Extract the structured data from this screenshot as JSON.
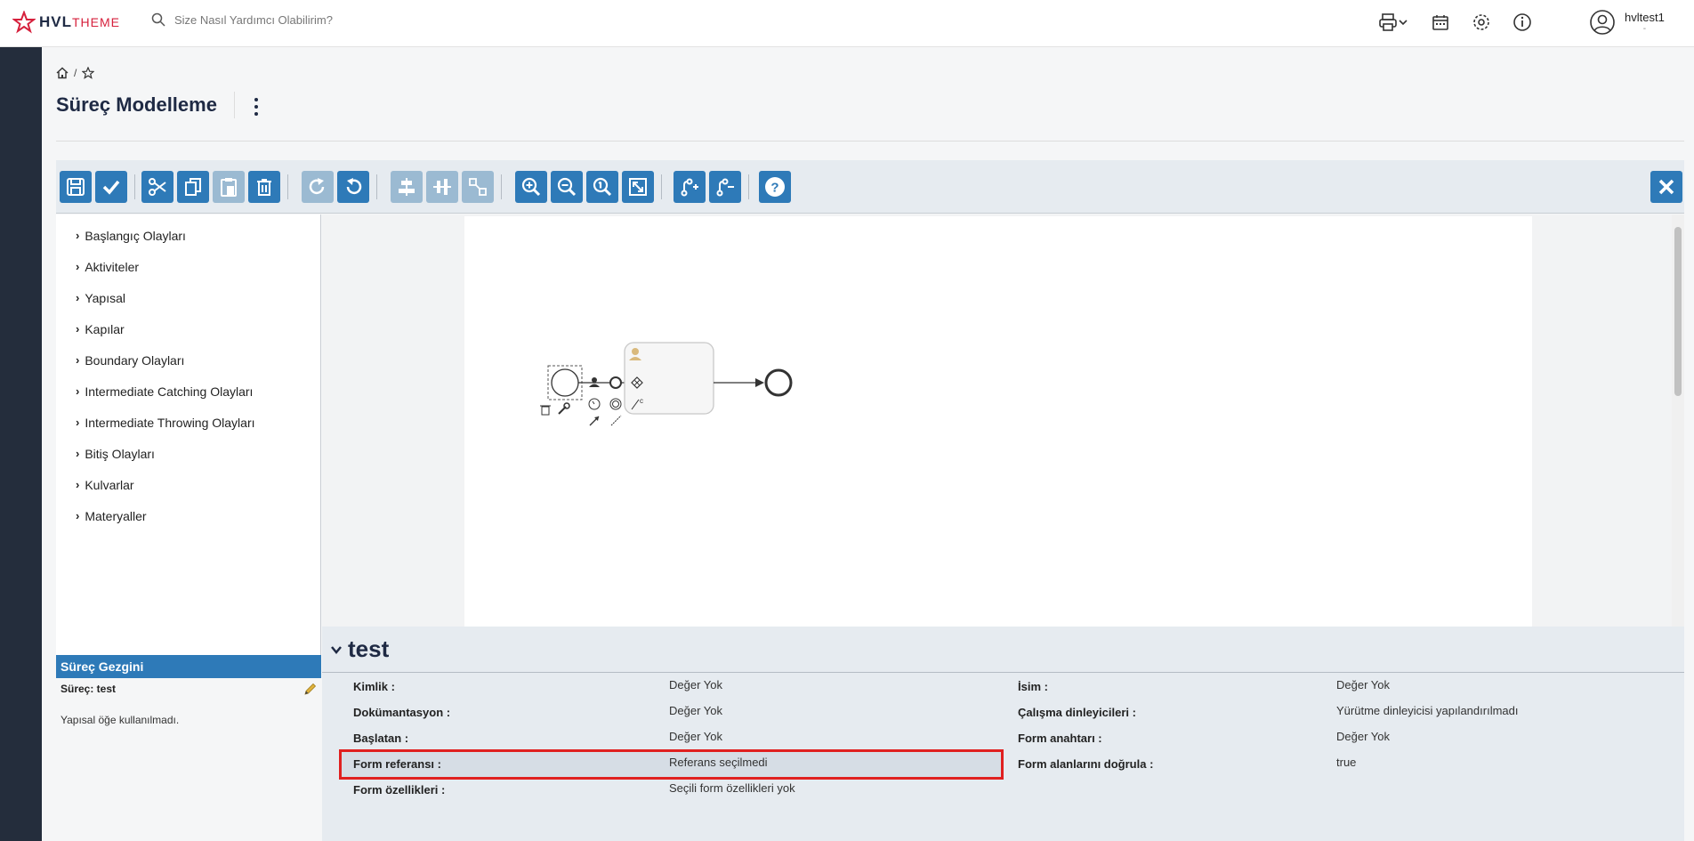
{
  "header": {
    "logo_main": "HVL",
    "logo_sub": "THEME",
    "search_placeholder": "Size Nasıl Yardımcı Olabilirim?",
    "user_name": "hvltest1",
    "user_sub": "-",
    "icons": [
      "print-icon",
      "chevron-down-icon",
      "calendar-icon",
      "gear-icon",
      "info-icon",
      "user-icon"
    ]
  },
  "breadcrumb": {
    "separator": "/"
  },
  "page": {
    "title": "Süreç Modelleme"
  },
  "toolbar": {
    "buttons": [
      "save-icon",
      "check-icon",
      "cut-icon",
      "copy-icon",
      "paste-icon",
      "delete-icon",
      "redo-icon",
      "undo-icon",
      "align-icon",
      "align-vertical-icon",
      "resize-icon",
      "zoom-in-icon",
      "zoom-out-icon",
      "zoom-actual-icon",
      "fit-icon",
      "add-docker-icon",
      "remove-docker-icon",
      "help-icon",
      "close-icon"
    ],
    "accent": "#2e7ab8"
  },
  "palette": {
    "items": [
      "Başlangıç Olayları",
      "Aktiviteler",
      "Yapısal",
      "Kapılar",
      "Boundary Olayları",
      "Intermediate Catching Olayları",
      "Intermediate Throwing Olayları",
      "Bitiş Olayları",
      "Kulvarlar",
      "Materyaller"
    ]
  },
  "navigator": {
    "title": "Süreç Gezgini",
    "process_label": "Süreç: test",
    "empty_text": "Yapısal öğe kullanılmadı."
  },
  "properties": {
    "title": "test",
    "left": [
      {
        "label": "Kimlik :",
        "value": "Değer Yok"
      },
      {
        "label": "Dokümantasyon :",
        "value": "Değer Yok"
      },
      {
        "label": "Başlatan :",
        "value": "Değer Yok"
      },
      {
        "label": "Form referansı :",
        "value": "Referans seçilmedi"
      },
      {
        "label": "Form özellikleri :",
        "value": "Seçili form özellikleri yok"
      }
    ],
    "right": [
      {
        "label": "İsim :",
        "value": "Değer Yok"
      },
      {
        "label": "Çalışma dinleyicileri :",
        "value": "Yürütme dinleyicisi yapılandırılmadı"
      },
      {
        "label": "Form anahtarı :",
        "value": "Değer Yok"
      },
      {
        "label": "Form alanlarını doğrula :",
        "value": "true"
      }
    ],
    "highlight_color": "#e02020"
  }
}
